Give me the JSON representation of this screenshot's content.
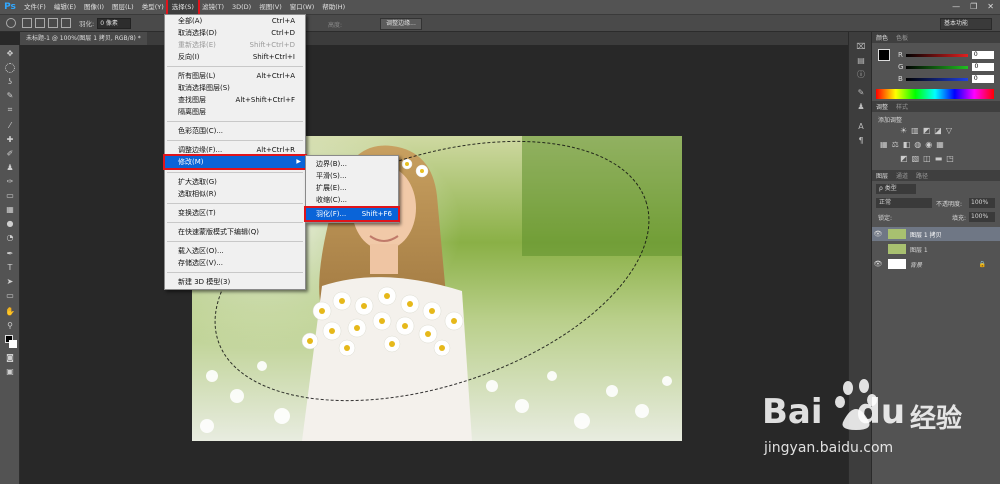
{
  "menubar": {
    "logo": "Ps",
    "items": [
      "文件(F)",
      "编辑(E)",
      "图像(I)",
      "图层(L)",
      "类型(Y)",
      "选择(S)",
      "滤镜(T)",
      "3D(D)",
      "视图(V)",
      "窗口(W)",
      "帮助(H)"
    ],
    "active_index": 5,
    "window_controls": [
      "—",
      "❐",
      "✕"
    ]
  },
  "options": {
    "feather_label": "羽化:",
    "feather_value": "0 像素",
    "width_label": "宽度:",
    "height_label": "高度:",
    "refine_edge": "调整边缘...",
    "workspace": "基本功能"
  },
  "doc_tab": "未标题-1 @ 100%(图层 1 拷贝, RGB/8) *",
  "select_menu": {
    "items": [
      {
        "label": "全部(A)",
        "shortcut": "Ctrl+A",
        "disabled": false
      },
      {
        "label": "取消选择(D)",
        "shortcut": "Ctrl+D",
        "disabled": false
      },
      {
        "label": "重新选择(E)",
        "shortcut": "Shift+Ctrl+D",
        "disabled": true
      },
      {
        "label": "反向(I)",
        "shortcut": "Shift+Ctrl+I",
        "disabled": false
      },
      {
        "label": "所有图层(L)",
        "shortcut": "Alt+Ctrl+A",
        "disabled": false
      },
      {
        "label": "取消选择图层(S)",
        "shortcut": "",
        "disabled": false
      },
      {
        "label": "查找图层",
        "shortcut": "Alt+Shift+Ctrl+F",
        "disabled": false
      },
      {
        "label": "隔离图层",
        "shortcut": "",
        "disabled": false
      },
      {
        "label": "色彩范围(C)...",
        "shortcut": "",
        "disabled": false
      },
      {
        "label": "调整边缘(F)...",
        "shortcut": "Alt+Ctrl+R",
        "disabled": false
      },
      {
        "label": "修改(M)",
        "shortcut": "",
        "disabled": false
      },
      {
        "label": "扩大选取(G)",
        "shortcut": "",
        "disabled": false
      },
      {
        "label": "选取相似(R)",
        "shortcut": "",
        "disabled": false
      },
      {
        "label": "变换选区(T)",
        "shortcut": "",
        "disabled": false
      },
      {
        "label": "在快速蒙版模式下编辑(Q)",
        "shortcut": "",
        "disabled": false
      },
      {
        "label": "载入选区(O)...",
        "shortcut": "",
        "disabled": false
      },
      {
        "label": "存储选区(V)...",
        "shortcut": "",
        "disabled": false
      },
      {
        "label": "新建 3D 模型(3)",
        "shortcut": "",
        "disabled": false
      }
    ]
  },
  "modify_submenu": {
    "items": [
      {
        "label": "边界(B)...",
        "shortcut": ""
      },
      {
        "label": "平滑(S)...",
        "shortcut": ""
      },
      {
        "label": "扩展(E)...",
        "shortcut": ""
      },
      {
        "label": "收缩(C)...",
        "shortcut": ""
      },
      {
        "label": "羽化(F)...",
        "shortcut": "Shift+F6"
      }
    ]
  },
  "color_panel": {
    "tabs": [
      "颜色",
      "色板"
    ],
    "channels": [
      {
        "name": "R",
        "value": "0",
        "color": "#e02020"
      },
      {
        "name": "G",
        "value": "0",
        "color": "#20c020"
      },
      {
        "name": "B",
        "value": "0",
        "color": "#2040e0"
      }
    ]
  },
  "adjust_panel": {
    "tabs": [
      "调整",
      "样式"
    ],
    "add_label": "添加调整"
  },
  "layers_panel": {
    "tabs": [
      "图层",
      "通道",
      "路径"
    ],
    "filter": "ρ 类型",
    "blend_mode": "正常",
    "opacity_label": "不透明度:",
    "opacity_value": "100%",
    "lock_label": "锁定:",
    "fill_label": "填充:",
    "fill_value": "100%",
    "layers": [
      {
        "name": "图层 1 拷贝",
        "selected": true,
        "visible": true
      },
      {
        "name": "图层 1",
        "selected": false,
        "visible": false
      },
      {
        "name": "背景",
        "selected": false,
        "visible": true
      }
    ]
  },
  "watermark": {
    "brand": "Bai",
    "brand2": "du",
    "cn": "经验",
    "url": "jingyan.baidu.com"
  }
}
